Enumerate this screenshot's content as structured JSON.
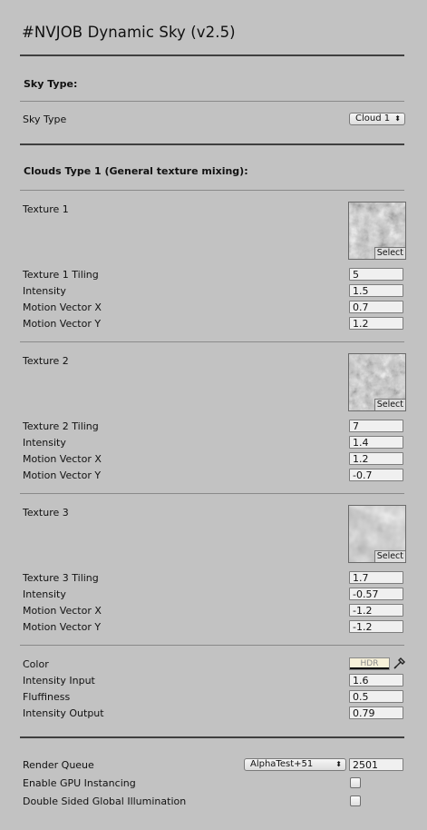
{
  "header": {
    "title": "#NVJOB Dynamic Sky (v2.5)"
  },
  "sky_type_section": {
    "heading": "Sky Type:",
    "label": "Sky Type",
    "value": "Cloud 1"
  },
  "clouds_section": {
    "heading": "Clouds Type 1 (General texture mixing):",
    "textures": [
      {
        "label": "Texture 1",
        "select_label": "Select",
        "rows": [
          {
            "label": "Texture 1 Tiling",
            "value": "5"
          },
          {
            "label": "Intensity",
            "value": "1.5"
          },
          {
            "label": "Motion Vector X",
            "value": "0.7"
          },
          {
            "label": "Motion Vector Y",
            "value": "1.2"
          }
        ]
      },
      {
        "label": "Texture 2",
        "select_label": "Select",
        "rows": [
          {
            "label": "Texture 2 Tiling",
            "value": "7"
          },
          {
            "label": "Intensity",
            "value": "1.4"
          },
          {
            "label": "Motion Vector X",
            "value": "1.2"
          },
          {
            "label": "Motion Vector Y",
            "value": "-0.7"
          }
        ]
      },
      {
        "label": "Texture 3",
        "select_label": "Select",
        "rows": [
          {
            "label": "Texture 3 Tiling",
            "value": "1.7"
          },
          {
            "label": "Intensity",
            "value": "-0.57"
          },
          {
            "label": "Motion Vector X",
            "value": "-1.2"
          },
          {
            "label": "Motion Vector Y",
            "value": "-1.2"
          }
        ]
      }
    ],
    "color": {
      "label": "Color",
      "hdr_label": "HDR",
      "swatch_color": "#f7f1d9"
    },
    "extra_rows": [
      {
        "label": "Intensity Input",
        "value": "1.6"
      },
      {
        "label": "Fluffiness",
        "value": "0.5"
      },
      {
        "label": "Intensity Output",
        "value": "0.79"
      }
    ]
  },
  "render_section": {
    "render_queue": {
      "label": "Render Queue",
      "option": "AlphaTest+51",
      "value": "2501"
    },
    "gpu_instancing": {
      "label": "Enable GPU Instancing",
      "checked": false
    },
    "double_sided_gi": {
      "label": "Double Sided Global Illumination",
      "checked": false
    }
  }
}
